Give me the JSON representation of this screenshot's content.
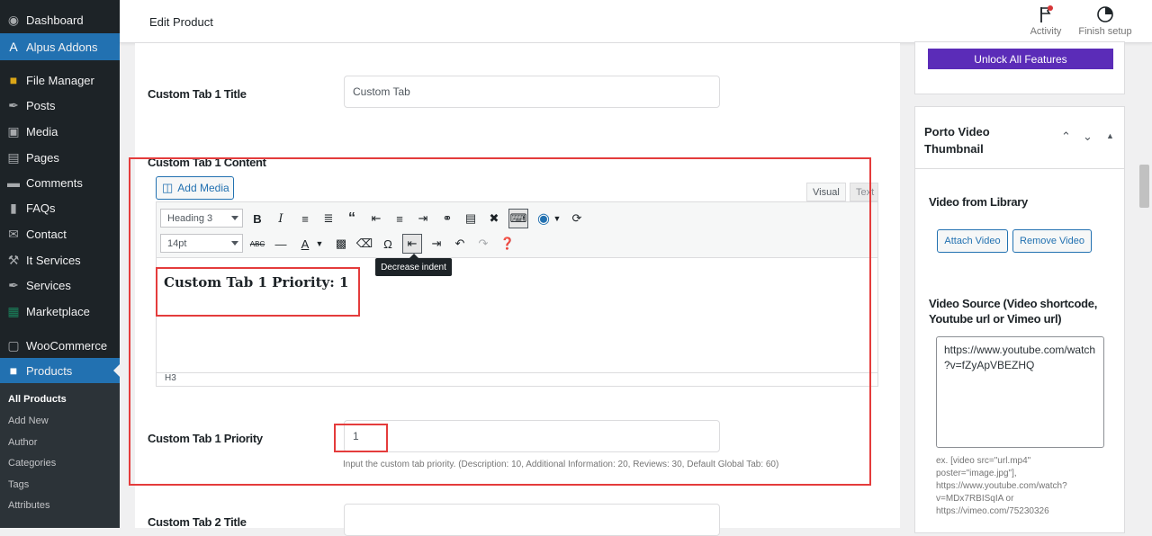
{
  "sidebar": {
    "items": [
      {
        "label": "Dashboard",
        "icon": "dashboard-icon",
        "glyph": "◉"
      },
      {
        "label": "Alpus Addons",
        "icon": "alpus-icon",
        "glyph": "A"
      },
      {
        "label": "File Manager",
        "icon": "folder-icon",
        "glyph": "■"
      },
      {
        "label": "Posts",
        "icon": "pin-icon",
        "glyph": "✒"
      },
      {
        "label": "Media",
        "icon": "media-icon",
        "glyph": "▣"
      },
      {
        "label": "Pages",
        "icon": "pages-icon",
        "glyph": "▤"
      },
      {
        "label": "Comments",
        "icon": "comment-icon",
        "glyph": "▬"
      },
      {
        "label": "FAQs",
        "icon": "book-icon",
        "glyph": "▮"
      },
      {
        "label": "Contact",
        "icon": "mail-icon",
        "glyph": "✉"
      },
      {
        "label": "It Services",
        "icon": "tools-icon",
        "glyph": "⚒"
      },
      {
        "label": "Services",
        "icon": "pin-icon",
        "glyph": "✒"
      },
      {
        "label": "Marketplace",
        "icon": "grid-icon",
        "glyph": "▦"
      },
      {
        "label": "WooCommerce",
        "icon": "woo-icon",
        "glyph": "▢"
      },
      {
        "label": "Products",
        "icon": "archive-icon",
        "glyph": "■"
      }
    ],
    "submenu": [
      "All Products",
      "Add New",
      "Author",
      "Categories",
      "Tags",
      "Attributes"
    ]
  },
  "header": {
    "title": "Edit Product",
    "activity": "Activity",
    "finish_setup": "Finish setup"
  },
  "main": {
    "tab1_title_label": "Custom Tab 1 Title",
    "tab1_title_value": "Custom Tab",
    "tab1_content_label": "Custom Tab 1 Content",
    "add_media": "Add Media",
    "tab_visual": "Visual",
    "tab_text": "Text",
    "format_select": "Heading 3",
    "size_select": "14pt",
    "tooltip": "Decrease indent",
    "editor_content": "Custom Tab 1 Priority: 1",
    "status_path": "H3",
    "tab1_priority_label": "Custom Tab 1 Priority",
    "tab1_priority_value": "1",
    "priority_hint": "Input the custom tab priority. (Description: 10, Additional Information: 20, Reviews: 30, Default Global Tab: 60)",
    "tab2_title_label": "Custom Tab 2 Title"
  },
  "right": {
    "unlock": "Unlock All Features",
    "video_panel_title_line1": "Porto Video",
    "video_panel_title_line2": "Thumbnail",
    "video_library_label": "Video from Library",
    "attach_video": "Attach Video",
    "remove_video": "Remove Video",
    "video_source_label_line1": "Video Source (Video shortcode,",
    "video_source_label_line2": "Youtube url or Vimeo url)",
    "video_source_line1": "https://www.youtube.com/watch",
    "video_source_line2": "?v=fZyApVBEZHQ",
    "example_lines": [
      "ex. [video src=\"url.mp4\"",
      "poster=\"image.jpg\"],",
      "https://www.youtube.com/watch?",
      "v=MDx7RBISqIA or",
      "https://vimeo.com/75230326"
    ]
  },
  "colors": {
    "accent": "#2271b1",
    "unlock": "#5b2cb8",
    "highlight": "#e43c3c"
  }
}
